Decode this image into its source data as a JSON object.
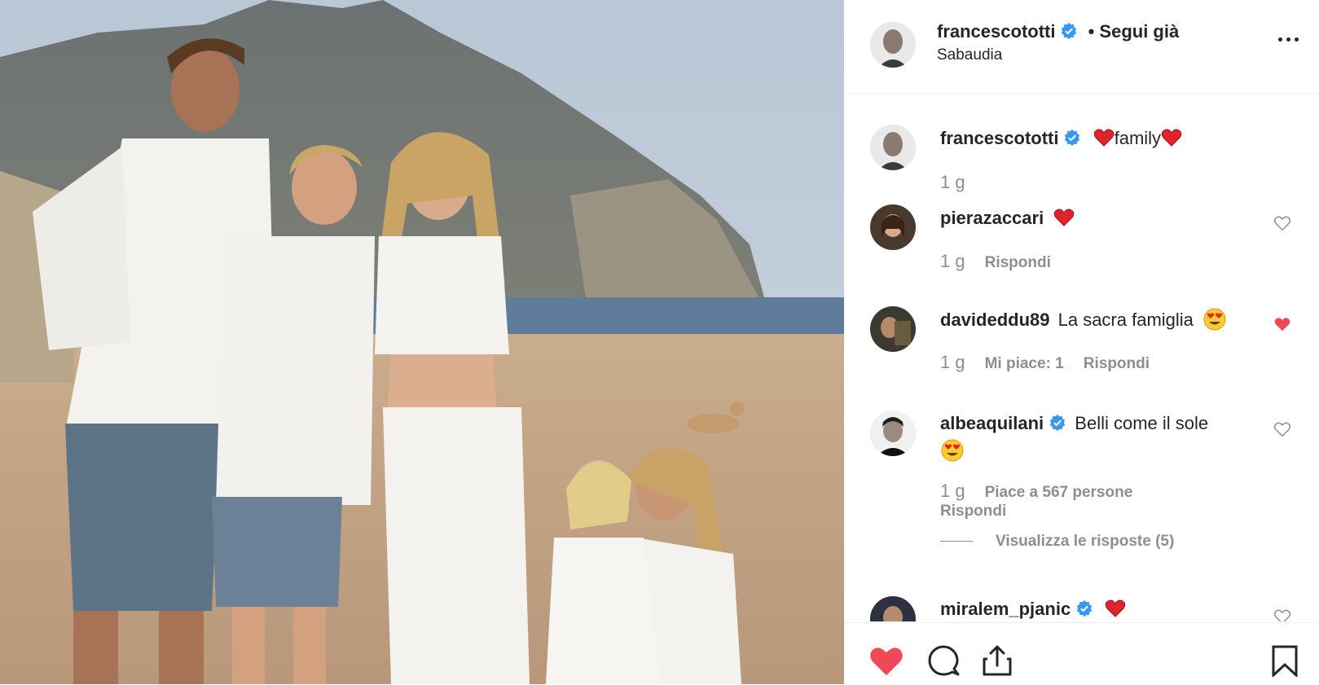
{
  "post": {
    "username": "francescototti",
    "follow_status": "• Segui già",
    "location": "Sabaudia",
    "more_label": "..."
  },
  "comments": [
    {
      "username": "francescototti",
      "verified": true,
      "text_before": "",
      "text_middle": "family",
      "time": "1 g",
      "is_caption": true
    },
    {
      "username": "pierazaccari",
      "verified": false,
      "time": "1 g",
      "reply_label": "Rispondi"
    },
    {
      "username": "davideddu89",
      "verified": false,
      "text": "La sacra famiglia",
      "time": "1 g",
      "likes_label": "Mi piace: 1",
      "reply_label": "Rispondi",
      "liked": true
    },
    {
      "username": "albeaquilani",
      "verified": true,
      "text": "Belli come il sole",
      "time": "1 g",
      "likes_label": "Piace a 567 persone",
      "reply_label": "Rispondi",
      "view_replies": "Visualizza le risposte (5)"
    },
    {
      "username": "miralem_pjanic",
      "verified": true
    }
  ],
  "actions": {
    "liked": true,
    "icons": [
      "heart-icon",
      "comment-icon",
      "share-icon",
      "bookmark-icon"
    ]
  },
  "colors": {
    "verified": "#3897f0",
    "like_red": "#ed4956",
    "text_dark": "#262626",
    "text_muted": "#8e8e8e"
  }
}
